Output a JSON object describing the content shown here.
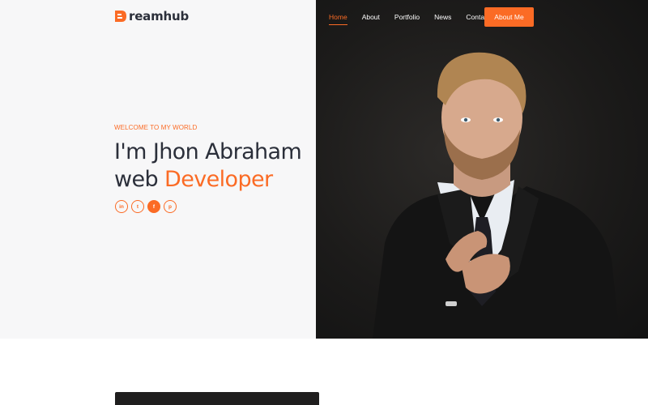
{
  "brand": {
    "logo_letter": "D",
    "logo_text": "reamhub"
  },
  "nav": {
    "items": [
      {
        "label": "Home",
        "active": true
      },
      {
        "label": "About",
        "active": false
      },
      {
        "label": "Portfolio",
        "active": false
      },
      {
        "label": "News",
        "active": false
      },
      {
        "label": "Contact",
        "active": false
      }
    ],
    "cta_label": "About Me"
  },
  "hero": {
    "welcome": "WELCOME TO MY WORLD",
    "headline_line1": "I'm Jhon Abraham",
    "headline_line2_prefix": "web",
    "headline_line2_accent": "Developer",
    "socials": [
      {
        "icon": "linkedin-icon",
        "glyph": "in"
      },
      {
        "icon": "twitter-icon",
        "glyph": "t"
      },
      {
        "icon": "facebook-icon",
        "glyph": "f"
      },
      {
        "icon": "pinterest-icon",
        "glyph": "p"
      }
    ]
  },
  "colors": {
    "accent": "#fb6b25",
    "dark_text": "#2b2f3a",
    "left_bg": "#f7f7f8",
    "photo_bg": "#1c1b1a"
  }
}
